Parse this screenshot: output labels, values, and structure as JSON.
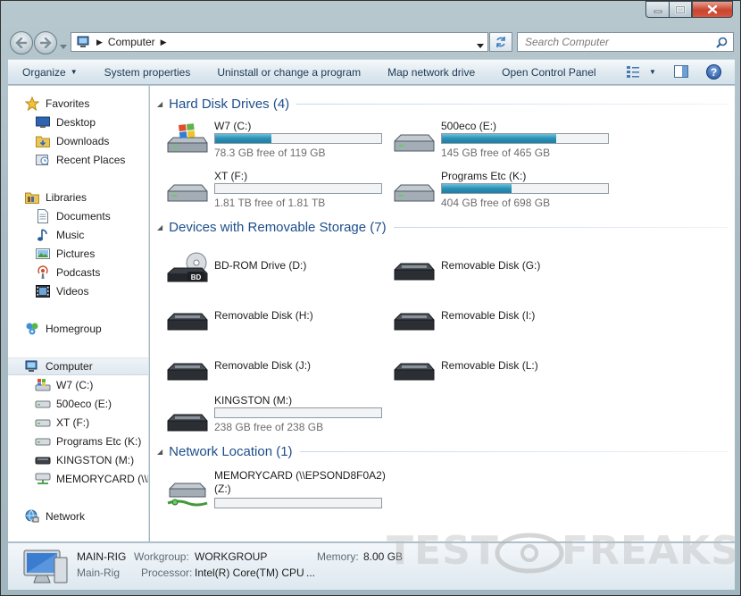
{
  "window": {
    "title": "Computer"
  },
  "address": {
    "crumbs": [
      "Computer"
    ],
    "search_placeholder": "Search Computer"
  },
  "toolbar": {
    "organize": "Organize",
    "system_properties": "System properties",
    "uninstall": "Uninstall or change a program",
    "map_drive": "Map network drive",
    "control_panel": "Open Control Panel",
    "help": "?"
  },
  "nav": {
    "favorites": "Favorites",
    "desktop": "Desktop",
    "downloads": "Downloads",
    "recent_places": "Recent Places",
    "libraries": "Libraries",
    "documents": "Documents",
    "music": "Music",
    "pictures": "Pictures",
    "podcasts": "Podcasts",
    "videos": "Videos",
    "homegroup": "Homegroup",
    "computer": "Computer",
    "drives": [
      "W7 (C:)",
      "500eco (E:)",
      "XT (F:)",
      "Programs Etc (K:)",
      "KINGSTON (M:)",
      "MEMORYCARD (\\\\E"
    ],
    "network": "Network"
  },
  "groups": {
    "hdd": "Hard Disk Drives (4)",
    "removable": "Devices with Removable Storage (7)",
    "network": "Network Location (1)"
  },
  "hdd": [
    {
      "name": "W7 (C:)",
      "free": "78.3 GB free of 119 GB",
      "used_fraction": 0.34
    },
    {
      "name": "500eco (E:)",
      "free": "145 GB free of 465 GB",
      "used_fraction": 0.69
    },
    {
      "name": "XT (F:)",
      "free": "1.81 TB free of 1.81 TB",
      "used_fraction": 0.0
    },
    {
      "name": "Programs Etc (K:)",
      "free": "404 GB free of 698 GB",
      "used_fraction": 0.42
    }
  ],
  "removable": [
    {
      "name": "BD-ROM Drive (D:)",
      "badge": "BD"
    },
    {
      "name": "Removable Disk (G:)"
    },
    {
      "name": "Removable Disk (H:)"
    },
    {
      "name": "Removable Disk (I:)"
    },
    {
      "name": "Removable Disk (J:)"
    },
    {
      "name": "Removable Disk (L:)"
    },
    {
      "name": "KINGSTON (M:)",
      "free": "238 GB free of 238 GB",
      "used_fraction": 0.0
    }
  ],
  "network_locations": [
    {
      "name": "MEMORYCARD (\\\\EPSOND8F0A2)",
      "name2": "(Z:)",
      "used_fraction": 0.0
    }
  ],
  "details": {
    "name": "MAIN-RIG",
    "workgroup_label": "Workgroup:",
    "workgroup": "WORKGROUP",
    "memory_label": "Memory:",
    "memory": "8.00 GB",
    "subname": "Main-Rig",
    "processor_label": "Processor:",
    "processor": "Intel(R) Core(TM) CPU",
    "ellipsis": "..."
  },
  "watermark": {
    "left": "TEST",
    "right": "FREAKS"
  },
  "colors": {
    "accent": "#1e4e8c",
    "bar_fill": "#2b8fb5",
    "link": "#1e3954"
  }
}
